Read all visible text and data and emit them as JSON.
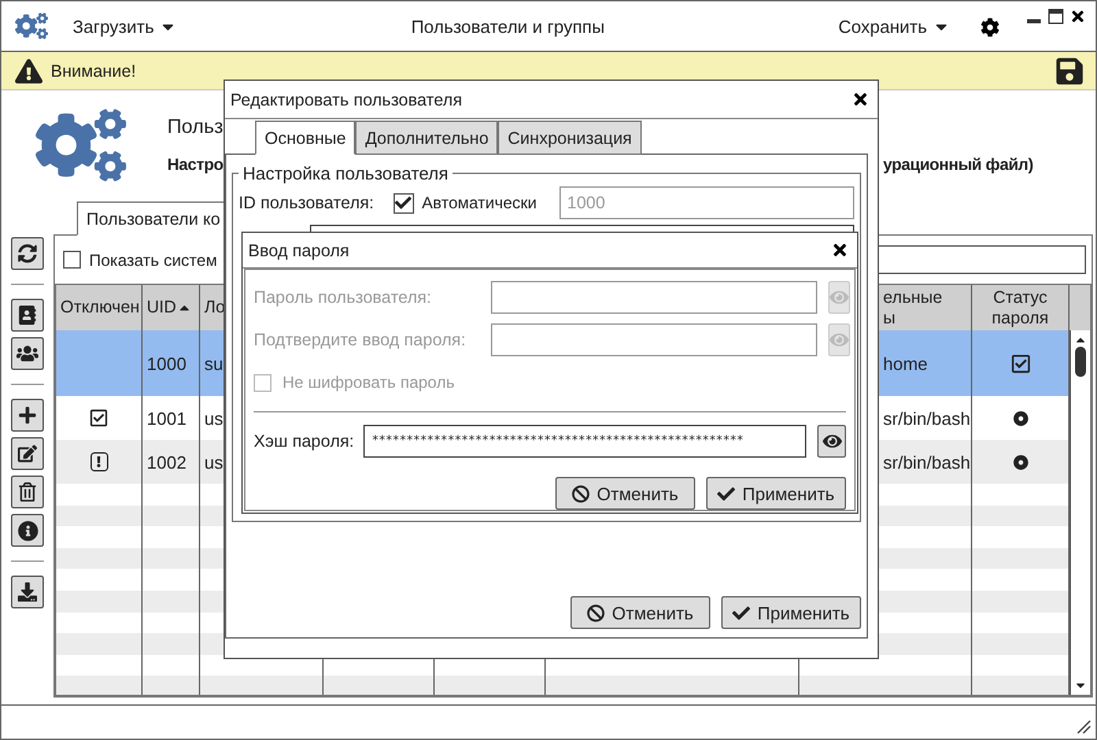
{
  "window": {
    "title": "Пользователи и группы",
    "load_menu": "Загрузить",
    "save_menu": "Сохранить"
  },
  "warning": {
    "text": "Внимание!"
  },
  "header": {
    "title": "Польз",
    "subtitle_left": "Настро",
    "subtitle_right": "урационный файл)"
  },
  "tabs": [
    {
      "label": "Пользователи ко",
      "selected": true
    }
  ],
  "show_system": {
    "label": "Показать систем",
    "checked": false
  },
  "table": {
    "columns": [
      {
        "label": "Отключен"
      },
      {
        "label": "UID",
        "sorted": true
      },
      {
        "label": "Ло"
      },
      {},
      {},
      {},
      {
        "label": "ельные\nы"
      },
      {
        "label": "Статус пароля"
      }
    ],
    "rows": [
      {
        "selected": true,
        "disabled": false,
        "alert": false,
        "uid": "1000",
        "login": "su",
        "shell": "home",
        "password_checked": true
      },
      {
        "selected": false,
        "disabled": true,
        "alert": false,
        "uid": "1001",
        "login": "us",
        "shell": "sr/bin/bash",
        "password_checked": false
      },
      {
        "selected": false,
        "disabled": false,
        "alert": true,
        "uid": "1002",
        "login": "us",
        "shell": "sr/bin/bash",
        "password_checked": false
      }
    ]
  },
  "edit_dialog": {
    "title": "Редактировать пользователя",
    "tabs": [
      {
        "label": "Основные",
        "selected": true
      },
      {
        "label": "Дополнительно",
        "selected": false
      },
      {
        "label": "Синхронизация",
        "selected": false
      }
    ],
    "group_title": "Настройка пользователя",
    "id_label": "ID пользователя:",
    "auto_label": "Автоматически",
    "auto_checked": true,
    "id_value": "1000",
    "cancel": "Отменить",
    "apply": "Применить"
  },
  "password_dialog": {
    "title": "Ввод пароля",
    "fields": [
      {
        "label": "Пароль пользователя:",
        "disabled": true
      },
      {
        "label": "Подтвердите ввод пароля:",
        "disabled": true
      }
    ],
    "no_encrypt": {
      "label": "Не шифровать пароль",
      "checked": false,
      "disabled": true
    },
    "hash": {
      "label": "Хэш пароля:",
      "value": "******************************************************"
    },
    "cancel": "Отменить",
    "apply": "Применить"
  }
}
